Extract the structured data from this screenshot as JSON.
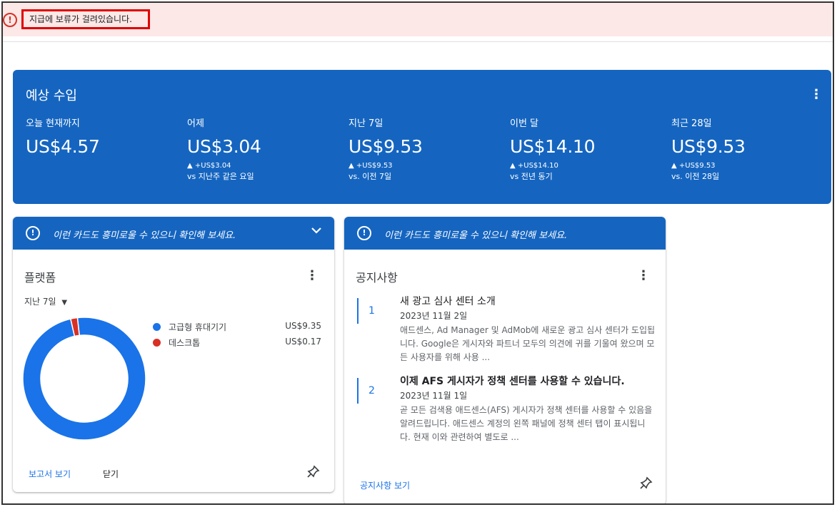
{
  "alert": {
    "icon": "error-icon",
    "message": "지급에 보류가 걸려있습니다.",
    "color": "#d93025"
  },
  "earnings": {
    "title": "예상 수입",
    "metrics": [
      {
        "label": "오늘 현재까지",
        "value": "US$4.57",
        "delta": "",
        "compare": ""
      },
      {
        "label": "어제",
        "value": "US$3.04",
        "delta": "▲ +US$3.04",
        "compare": "vs 지난주 같은 요일"
      },
      {
        "label": "지난 7일",
        "value": "US$9.53",
        "delta": "▲ +US$9.53",
        "compare": "vs. 이전 7일"
      },
      {
        "label": "이번 달",
        "value": "US$14.10",
        "delta": "▲ +US$14.10",
        "compare": "vs 전년 동기"
      },
      {
        "label": "최근 28일",
        "value": "US$9.53",
        "delta": "▲ +US$9.53",
        "compare": "vs. 이전 28일"
      }
    ],
    "color": "#1565c0"
  },
  "platform_card": {
    "tip": "이런 카드도 흥미로울 수 있으니 확인해 보세요.",
    "title": "플랫폼",
    "period": "지난 7일",
    "legend": [
      {
        "name": "고급형 휴대기기",
        "value": "US$9.35",
        "color": "#1a73e8"
      },
      {
        "name": "데스크톱",
        "value": "US$0.17",
        "color": "#d93025"
      }
    ],
    "view_report": "보고서 보기",
    "close": "닫기"
  },
  "chart_data": {
    "type": "pie",
    "categories": [
      "고급형 휴대기기",
      "데스크톱"
    ],
    "values": [
      9.35,
      0.17
    ],
    "colors": [
      "#1a73e8",
      "#d93025"
    ],
    "title": "",
    "donut": true
  },
  "notices_card": {
    "tip": "이런 카드도 흥미로울 수 있으니 확인해 보세요.",
    "title": "공지사항",
    "items": [
      {
        "num": "1",
        "title": "새 광고 심사 센터 소개",
        "date": "2023년 11월 2일",
        "body": "애드센스, Ad Manager 및 AdMob에 새로운 광고 심사 센터가 도입됩니다. Google은 게시자와 파트너 모두의 의견에 귀를 기울여 왔으며 모든 사용자를 위해 사용 ..."
      },
      {
        "num": "2",
        "title": "이제 AFS 게시자가 정책 센터를 사용할 수 있습니다.",
        "date": "2023년 11월 1일",
        "body": "곧 모든 검색용 애드센스(AFS) 게시자가 정책 센터를 사용할 수 있음을 알려드립니다. 애드센스 계정의 왼쪽 패널에 정책 센터 탭이 표시됩니다. 현재 이와 관련하여 별도로 ..."
      }
    ],
    "view_notices": "공지사항 보기"
  }
}
